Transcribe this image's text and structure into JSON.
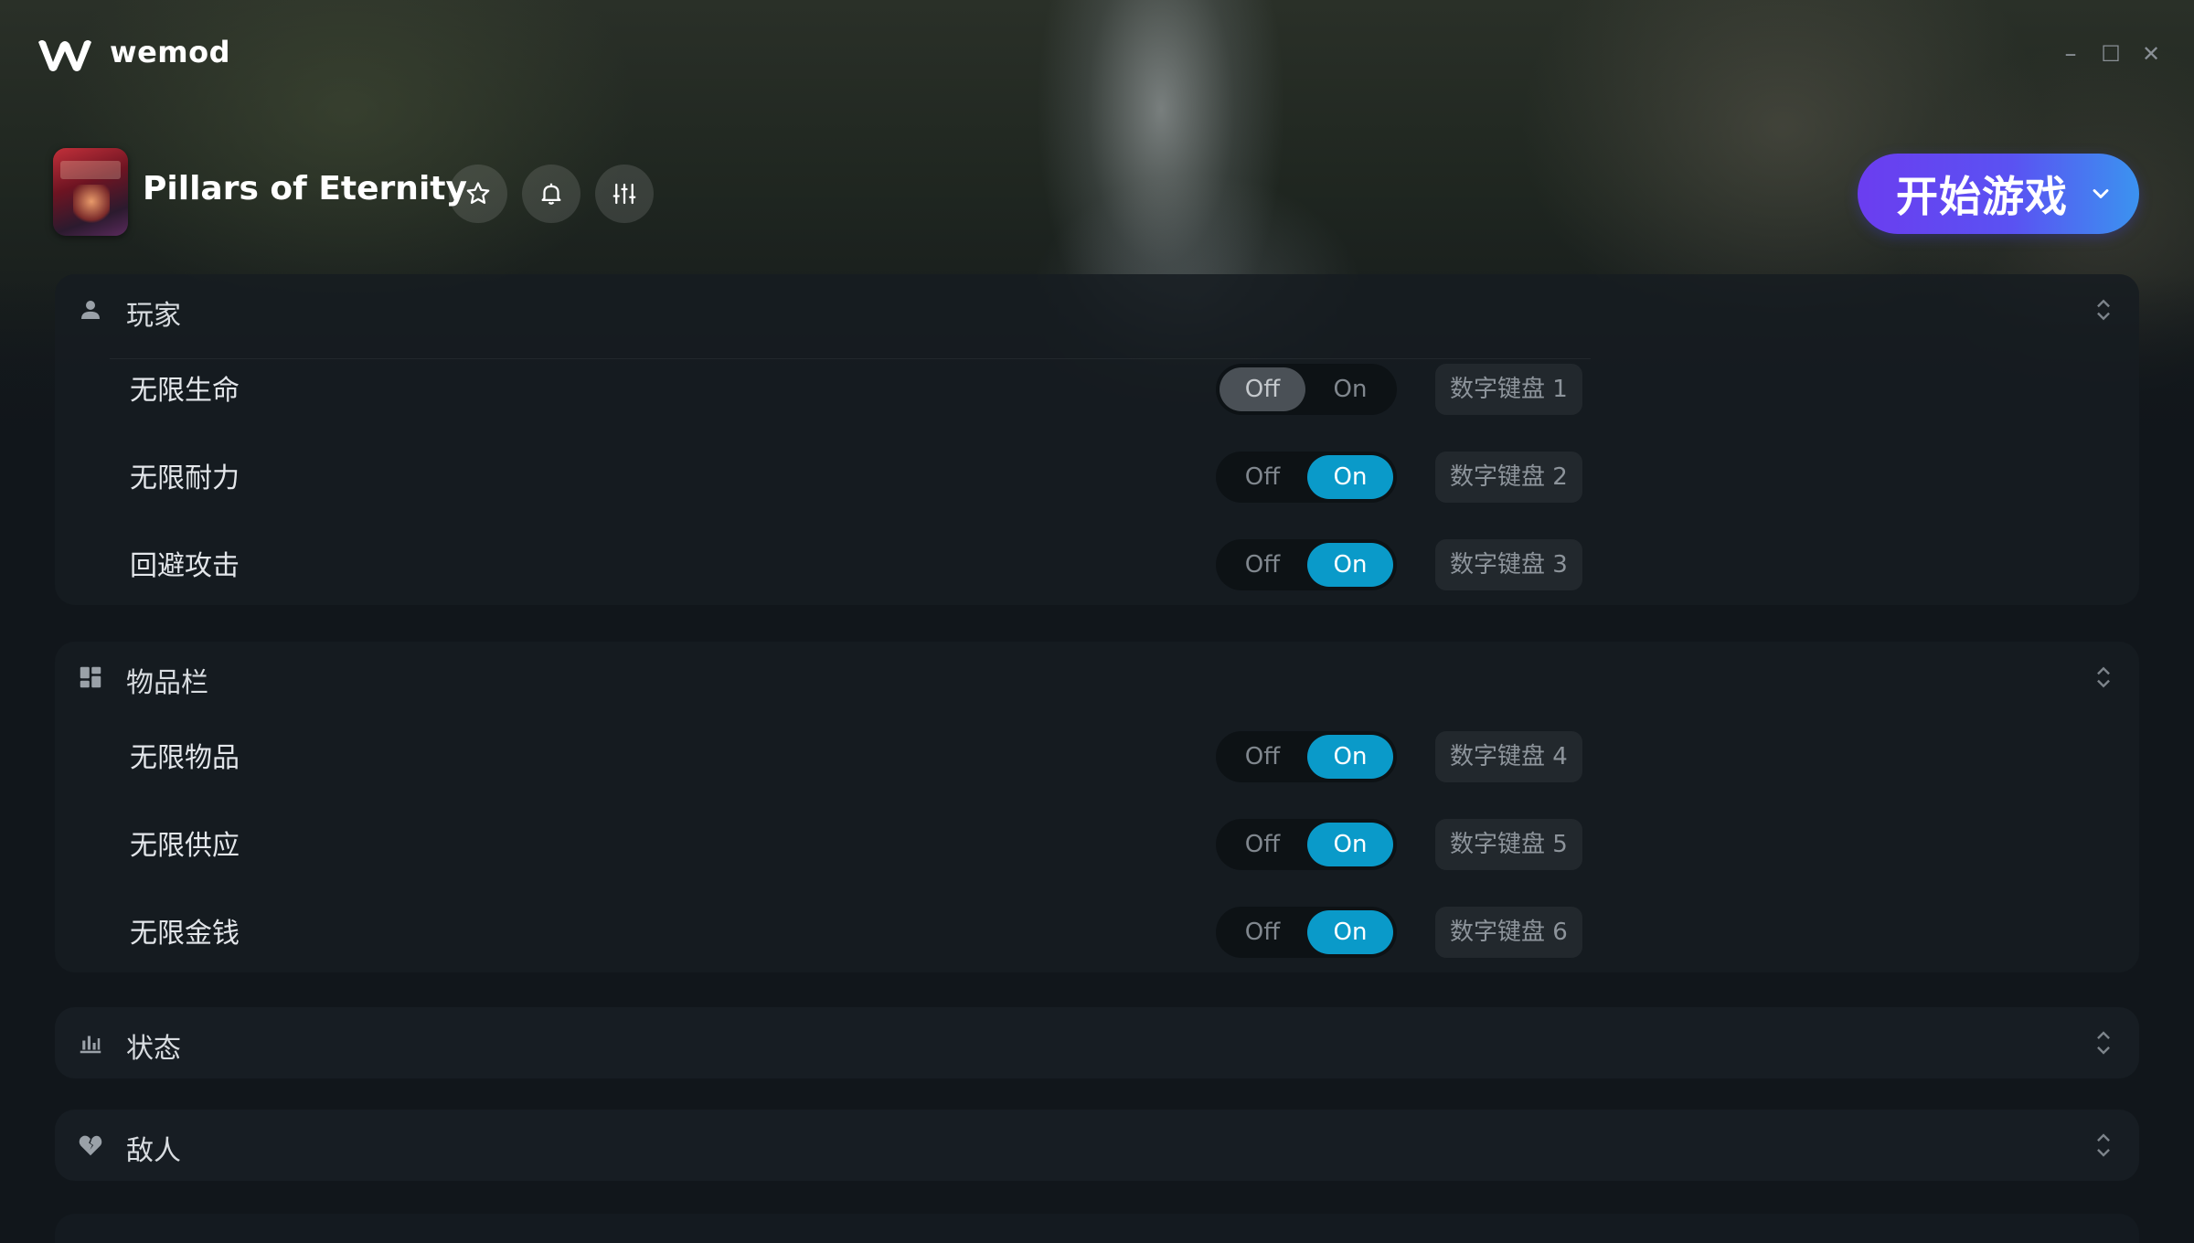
{
  "app": {
    "brand": "wemod"
  },
  "window_controls": {
    "minimize": "–",
    "maximize": "☐",
    "close": "✕"
  },
  "game": {
    "title": "Pillars of Eternity"
  },
  "play": {
    "label": "开始游戏"
  },
  "colors": {
    "toggle_on": "#0a9ac9",
    "play_gradient_start": "#6b3df0",
    "play_gradient_end": "#3b93f0"
  },
  "sections": [
    {
      "title": "玩家",
      "icon": "person-icon",
      "expanded": true,
      "rows": [
        {
          "label": "无限生命",
          "off_label": "Off",
          "on_label": "On",
          "state": "off",
          "hotkey": "数字键盘 1"
        },
        {
          "label": "无限耐力",
          "off_label": "Off",
          "on_label": "On",
          "state": "on",
          "hotkey": "数字键盘 2"
        },
        {
          "label": "回避攻击",
          "off_label": "Off",
          "on_label": "On",
          "state": "on",
          "hotkey": "数字键盘 3"
        }
      ]
    },
    {
      "title": "物品栏",
      "icon": "grid-icon",
      "expanded": true,
      "rows": [
        {
          "label": "无限物品",
          "off_label": "Off",
          "on_label": "On",
          "state": "on",
          "hotkey": "数字键盘 4"
        },
        {
          "label": "无限供应",
          "off_label": "Off",
          "on_label": "On",
          "state": "on",
          "hotkey": "数字键盘 5"
        },
        {
          "label": "无限金钱",
          "off_label": "Off",
          "on_label": "On",
          "state": "on",
          "hotkey": "数字键盘 6"
        }
      ]
    },
    {
      "title": "状态",
      "icon": "bar-chart-icon",
      "expanded": false,
      "rows": []
    },
    {
      "title": "敌人",
      "icon": "broken-heart-icon",
      "expanded": false,
      "rows": []
    }
  ]
}
